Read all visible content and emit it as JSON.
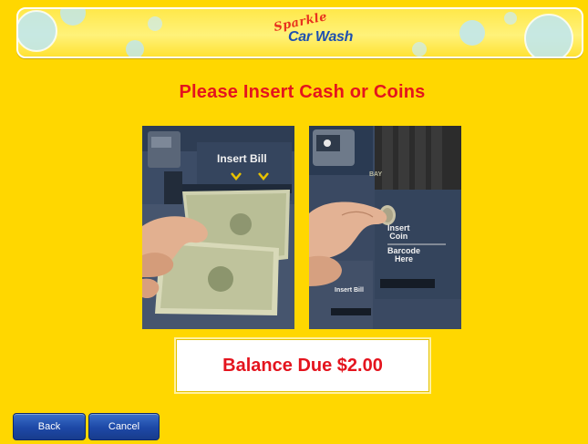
{
  "header": {
    "logo_top": "Sparkle",
    "logo_bottom": "Car Wash"
  },
  "main": {
    "heading": "Please Insert Cash or Coins",
    "bill_photo": {
      "label": "Insert Bill"
    },
    "coin_photo": {
      "bay_label": "BAY",
      "coin_label_line1": "Insert",
      "coin_label_line2": "Coin",
      "barcode_label_line1": "Barcode",
      "barcode_label_line2": "Here",
      "small_bill_label": "Insert Bill"
    },
    "balance": "Balance Due $2.00"
  },
  "footer": {
    "back_label": "Back",
    "cancel_label": "Cancel"
  },
  "colors": {
    "background": "#FFD700",
    "heading": "#E4141E",
    "button": "#1D48A6"
  }
}
